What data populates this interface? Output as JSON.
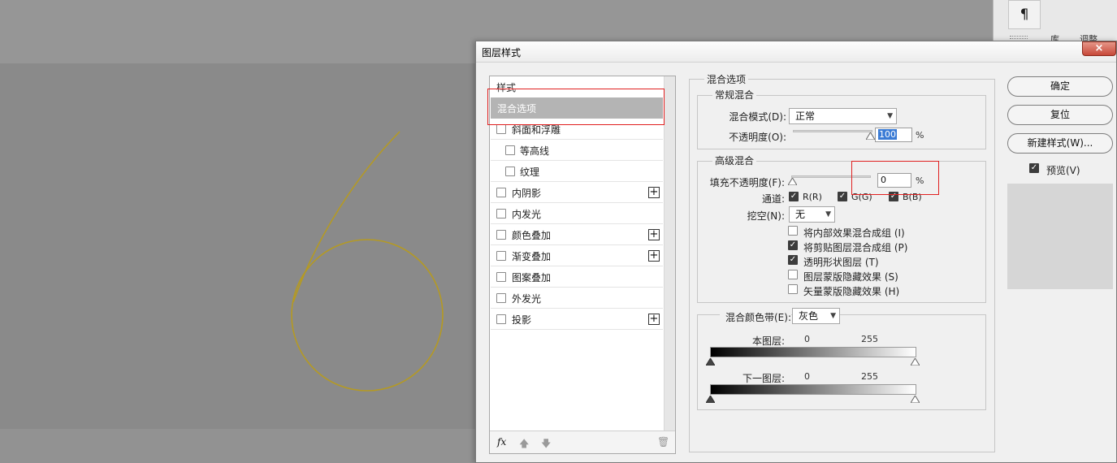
{
  "side_panel": {
    "pilcrow": "¶",
    "tab_library": "库",
    "tab_adjust": "调整"
  },
  "dialog": {
    "title": "图层样式",
    "close": "×",
    "style_list": {
      "header": "样式",
      "selected": "混合选项",
      "items": [
        {
          "label": "斜面和浮雕",
          "checked": false,
          "plus": false
        },
        {
          "label": "等高线",
          "checked": false,
          "plus": false
        },
        {
          "label": "纹理",
          "checked": false,
          "plus": false
        },
        {
          "label": "内阴影",
          "checked": false,
          "plus": true
        },
        {
          "label": "内发光",
          "checked": false,
          "plus": false
        },
        {
          "label": "颜色叠加",
          "checked": false,
          "plus": true
        },
        {
          "label": "渐变叠加",
          "checked": false,
          "plus": true
        },
        {
          "label": "图案叠加",
          "checked": false,
          "plus": false
        },
        {
          "label": "外发光",
          "checked": false,
          "plus": false
        },
        {
          "label": "投影",
          "checked": false,
          "plus": true
        }
      ],
      "footer": {
        "fx": "fx",
        "up": "🡅",
        "down": "🡇",
        "trash": "🗑"
      }
    },
    "blend_options": {
      "title": "混合选项",
      "general": {
        "title": "常规混合",
        "mode_label": "混合模式(D):",
        "mode_value": "正常",
        "opacity_label": "不透明度(O):",
        "opacity_value": "100",
        "unit": "%"
      },
      "advanced": {
        "title": "高级混合",
        "fill_label": "填充不透明度(F):",
        "fill_value": "0",
        "unit": "%",
        "channels_label": "通道:",
        "channels": [
          {
            "label": "R(R)",
            "checked": true
          },
          {
            "label": "G(G)",
            "checked": true
          },
          {
            "label": "B(B)",
            "checked": true
          }
        ],
        "knockout_label": "挖空(N):",
        "knockout_value": "无",
        "options": [
          {
            "label": "将内部效果混合成组 (I)",
            "checked": false
          },
          {
            "label": "将剪贴图层混合成组 (P)",
            "checked": true
          },
          {
            "label": "透明形状图层 (T)",
            "checked": true
          },
          {
            "label": "图层蒙版隐藏效果 (S)",
            "checked": false
          },
          {
            "label": "矢量蒙版隐藏效果 (H)",
            "checked": false
          }
        ]
      },
      "blend_if": {
        "label": "混合颜色带(E):",
        "value": "灰色",
        "this_layer": "本图层:",
        "underlying": "下一图层:",
        "low": "0",
        "high": "255"
      }
    },
    "buttons": {
      "ok": "确定",
      "reset": "复位",
      "new_style": "新建样式(W)...",
      "preview_label": "预览(V)",
      "preview_checked": true
    }
  },
  "colors": {
    "accent_outline": "#e02020",
    "shape_stroke": "#b59a22",
    "selected_row": "#b4b4b4"
  }
}
